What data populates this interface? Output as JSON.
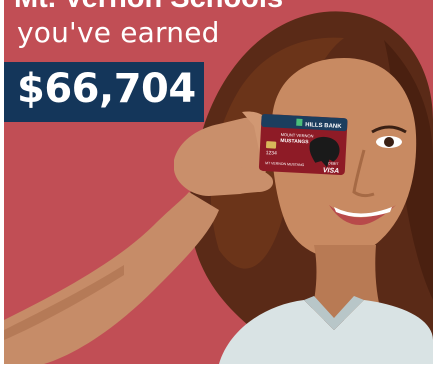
{
  "ad": {
    "headline_line1": "Mt. Vernon Schools",
    "headline_line2": "you've earned",
    "amount": "$66,704"
  },
  "card": {
    "bank_name": "HILLS BANK",
    "school_line1": "MOUNT VERNON",
    "school_line2": "MUSTANGS",
    "number": "1234",
    "holder": "MT VERNON MUSTANG",
    "debit_label": "DEBIT",
    "network": "VISA"
  },
  "colors": {
    "background": "#c14e55",
    "amount_box": "#14365a",
    "card": "#8e1b26",
    "card_header": "#1b3e5e"
  }
}
